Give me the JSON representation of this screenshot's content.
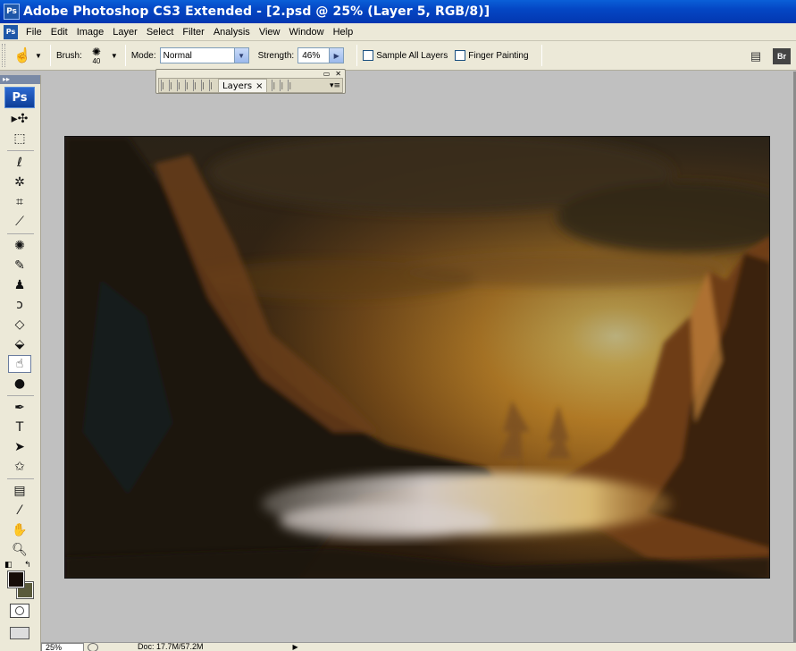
{
  "window": {
    "title": "Adobe Photoshop CS3 Extended - [2.psd @ 25% (Layer 5, RGB/8)]",
    "app_icon_text": "Ps"
  },
  "menubar": {
    "items": [
      "File",
      "Edit",
      "Image",
      "Layer",
      "Select",
      "Filter",
      "Analysis",
      "View",
      "Window",
      "Help"
    ]
  },
  "options": {
    "brush_label": "Brush:",
    "brush_size": "40",
    "mode_label": "Mode:",
    "mode_value": "Normal",
    "strength_label": "Strength:",
    "strength_value": "46%",
    "sample_all_layers": "Sample All Layers",
    "sample_all_layers_checked": false,
    "finger_painting": "Finger Painting",
    "finger_painting_checked": false,
    "bridge_label": "Br"
  },
  "layers_palette": {
    "tab_label": "Layers",
    "tab_close": "×"
  },
  "toolbox": {
    "logo": "Ps",
    "tools": [
      {
        "name": "move-tool",
        "glyph": "▸✣"
      },
      {
        "name": "marquee-tool",
        "glyph": "⬚"
      },
      {
        "name": "lasso-tool",
        "glyph": "ℓ"
      },
      {
        "name": "magic-wand-tool",
        "glyph": "✲"
      },
      {
        "name": "crop-tool",
        "glyph": "⌗"
      },
      {
        "name": "eyedropper-slice-tool",
        "glyph": "⟋"
      },
      {
        "name": "spot-healing-tool",
        "glyph": "✺"
      },
      {
        "name": "brush-tool",
        "glyph": "✎"
      },
      {
        "name": "clone-stamp-tool",
        "glyph": "♟"
      },
      {
        "name": "history-brush-tool",
        "glyph": "ↄ"
      },
      {
        "name": "eraser-tool",
        "glyph": "◇"
      },
      {
        "name": "paint-bucket-tool",
        "glyph": "⬙"
      },
      {
        "name": "smudge-tool",
        "glyph": "☝",
        "active": true
      },
      {
        "name": "dodge-tool",
        "glyph": "●"
      },
      {
        "name": "pen-tool",
        "glyph": "✒"
      },
      {
        "name": "type-tool",
        "glyph": "T"
      },
      {
        "name": "path-selection-tool",
        "glyph": "➤"
      },
      {
        "name": "custom-shape-tool",
        "glyph": "✩"
      },
      {
        "name": "notes-tool",
        "glyph": "▤"
      },
      {
        "name": "eyedropper-tool",
        "glyph": "⁄"
      },
      {
        "name": "hand-tool",
        "glyph": "✋"
      },
      {
        "name": "zoom-tool",
        "glyph": "🔍︎"
      }
    ],
    "foreground_color": "#160d08",
    "background_color": "#5a5a3b"
  },
  "status": {
    "zoom": "25%",
    "doc": "Doc: 17.7M/57.2M"
  },
  "canvas": {
    "description_colors": {
      "sky": "#d99a2e",
      "sun": "#fff3a0",
      "dark_rock": "#1c120a",
      "mist": "#d8d0c8"
    }
  }
}
